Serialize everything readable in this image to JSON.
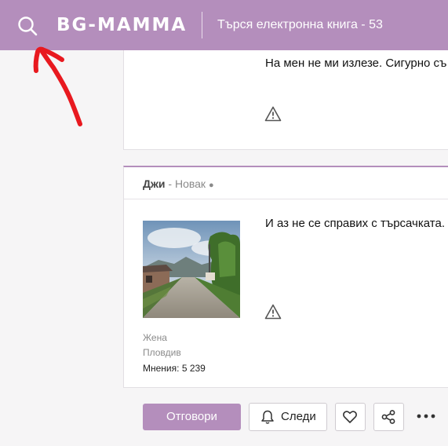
{
  "header": {
    "logo_text": "BG-MAMMA",
    "page_title": "Търся електронна книга - 53",
    "search_icon": "search-icon"
  },
  "posts": [
    {
      "text": "На мен не ми излезе.  Сигурно съ",
      "report_icon": "warning-icon"
    },
    {
      "author": "Джи",
      "separator": " - ",
      "rank": "Новак",
      "status_dot": "●",
      "text": "И аз не се справих с търсачката.",
      "report_icon": "warning-icon",
      "gender": "Жена",
      "city": "Пловдив",
      "opinions_label": "Мнения:",
      "opinions_count": "5 239"
    }
  ],
  "actions": {
    "reply_label": "Отговори",
    "follow_label": "Следи",
    "follow_icon": "bell-icon",
    "like_icon": "heart-icon",
    "share_icon": "share-icon",
    "more_label": "•••"
  },
  "colors": {
    "brand": "#b48ebc",
    "annotation_arrow": "#e8191f"
  }
}
